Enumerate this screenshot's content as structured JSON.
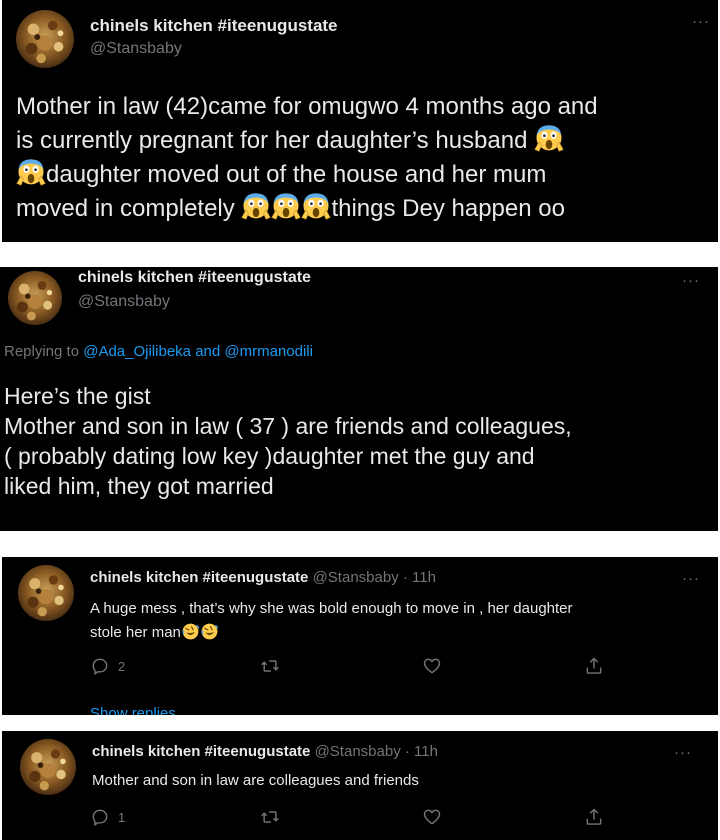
{
  "tweets": [
    {
      "name": "chinels kitchen #iteenugustate",
      "handle": "@Stansbaby",
      "line1": "Mother in law (42)came for omugwo 4 months ago and",
      "line2": "is  currently pregnant for her daughter’s husband",
      "line3": "daughter moved out of the house and her mum",
      "line4a": "moved in completely",
      "line4b": "things Dey happen oo",
      "emoji_name": "face-screaming-in-fear"
    },
    {
      "name": "chinels kitchen #iteenugustate",
      "handle": "@Stansbaby",
      "replying_prefix": "Replying to",
      "mention1": "@Ada_Ojilibeka",
      "and_word": "and",
      "mention2": "@mrmanodili",
      "line1": "Here’s the gist",
      "line2": "Mother and son in law ( 37 ) are friends and colleagues,",
      "line3": "( probably dating low key )daughter met the guy and",
      "line4": "liked him, they got married"
    },
    {
      "name": "chinels kitchen #iteenugustate",
      "handle": "@Stansbaby",
      "time": "· 11h",
      "line1": "A huge mess , that’s why she was bold enough to move in , her daughter",
      "line2": "stole her man",
      "emoji_name": "rolling-on-floor-laughing",
      "reply_count": "2",
      "show_replies": "Show replies"
    },
    {
      "name": "chinels kitchen #iteenugustate",
      "handle": "@Stansbaby",
      "time": "· 11h",
      "line1": "Mother and son in law are colleagues and friends",
      "reply_count": "1"
    }
  ],
  "colors": {
    "background": "#000000",
    "text": "#e7e9ea",
    "muted": "#71767b",
    "link": "#1d9bf0",
    "page": "#ffffff"
  }
}
